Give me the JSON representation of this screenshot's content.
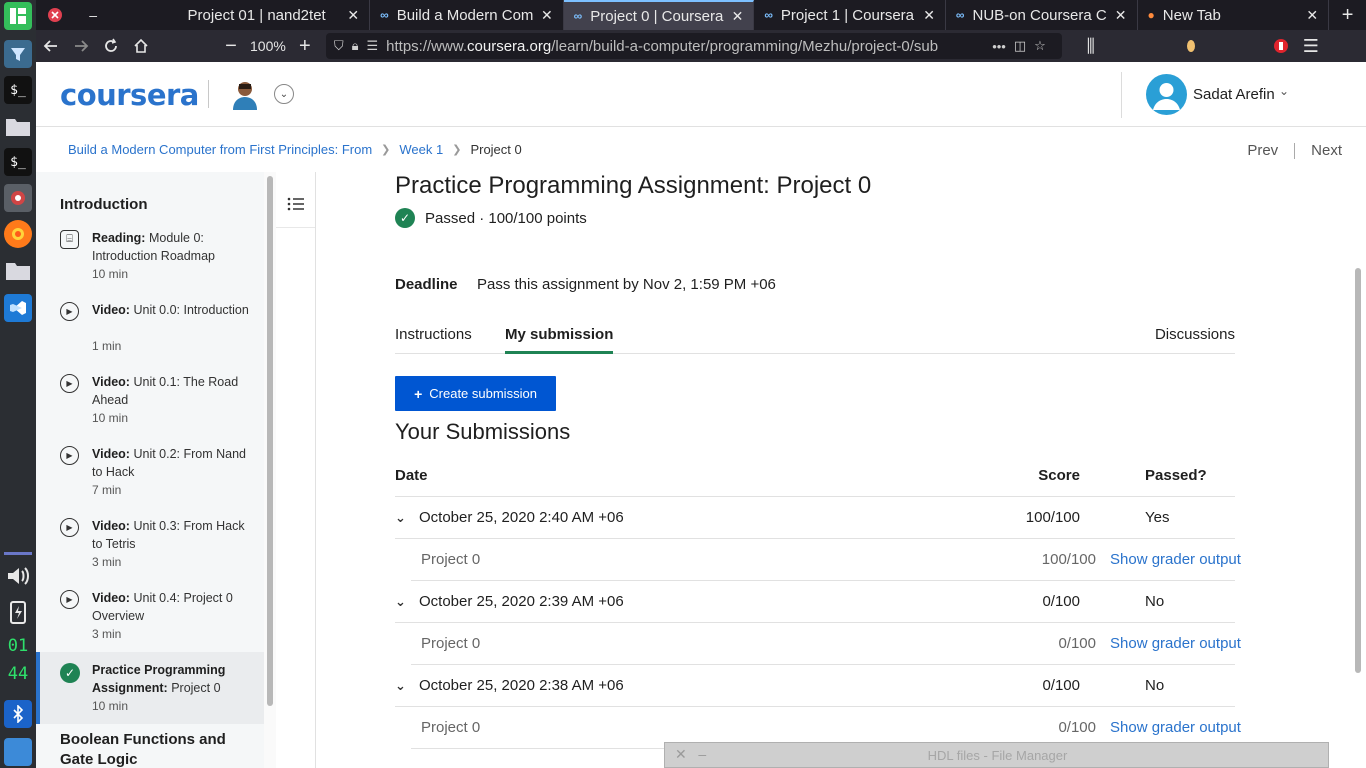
{
  "taskbar": {
    "clock_hour": "01",
    "clock_minute": "44"
  },
  "browser": {
    "tabs": [
      {
        "title": "Project 01 | nand2tet",
        "active": false
      },
      {
        "title": "Build a Modern Comp",
        "active": false
      },
      {
        "title": "Project 0 | Coursera",
        "active": true
      },
      {
        "title": "Project 1 | Coursera",
        "active": false
      },
      {
        "title": "NUB-on Coursera Ca",
        "active": false
      },
      {
        "title": "New Tab",
        "active": false
      }
    ],
    "zoom": "100%",
    "url_prefix": "https://www.",
    "url_domain": "coursera.org",
    "url_path": "/learn/build-a-computer/programming/Mezhu/project-0/sub"
  },
  "header": {
    "logo": "coursera",
    "user_name": "Sadat Arefin"
  },
  "breadcrumb": {
    "course": "Build a Modern Computer from First Principles: From",
    "week": "Week 1",
    "current": "Project 0"
  },
  "pager": {
    "prev": "Prev",
    "next": "Next"
  },
  "sidebar": {
    "section1": "Introduction",
    "items": [
      {
        "kind": "Reading:",
        "title": "Module 0: Introduction Roadmap",
        "duration": "10 min"
      },
      {
        "kind": "Video:",
        "title": "Unit 0.0: Introduction",
        "duration": "1 min"
      },
      {
        "kind": "Video:",
        "title": "Unit 0.1: The Road Ahead",
        "duration": "10 min"
      },
      {
        "kind": "Video:",
        "title": "Unit 0.2: From Nand to Hack",
        "duration": "7 min"
      },
      {
        "kind": "Video:",
        "title": "Unit 0.3: From Hack to Tetris",
        "duration": "3 min"
      },
      {
        "kind": "Video:",
        "title": "Unit 0.4: Project 0 Overview",
        "duration": "3 min"
      },
      {
        "kind": "Practice Programming Assignment:",
        "title": "Project 0",
        "duration": "10 min"
      }
    ],
    "section2": "Boolean Functions and Gate Logic"
  },
  "main": {
    "title": "Practice Programming Assignment: Project 0",
    "status": "Passed · 100/100 points",
    "deadline_label": "Deadline",
    "deadline_value": "Pass this assignment by Nov 2, 1:59 PM +06",
    "tabs": {
      "instructions": "Instructions",
      "my_submission": "My submission",
      "discussions": "Discussions"
    },
    "create_button": "Create submission",
    "submissions_heading": "Your Submissions",
    "table_headers": {
      "date": "Date",
      "score": "Score",
      "passed": "Passed?"
    },
    "submissions": [
      {
        "date": "October 25, 2020 2:40 AM +06",
        "score": "100/100",
        "passed": "Yes",
        "part": "Project 0",
        "part_score": "100/100",
        "link": "Show grader output"
      },
      {
        "date": "October 25, 2020 2:39 AM +06",
        "score": "0/100",
        "passed": "No",
        "part": "Project 0",
        "part_score": "0/100",
        "link": "Show grader output"
      },
      {
        "date": "October 25, 2020 2:38 AM +06",
        "score": "0/100",
        "passed": "No",
        "part": "Project 0",
        "part_score": "0/100",
        "link": "Show grader output"
      }
    ]
  },
  "file_manager": {
    "title": "HDL files - File Manager"
  }
}
